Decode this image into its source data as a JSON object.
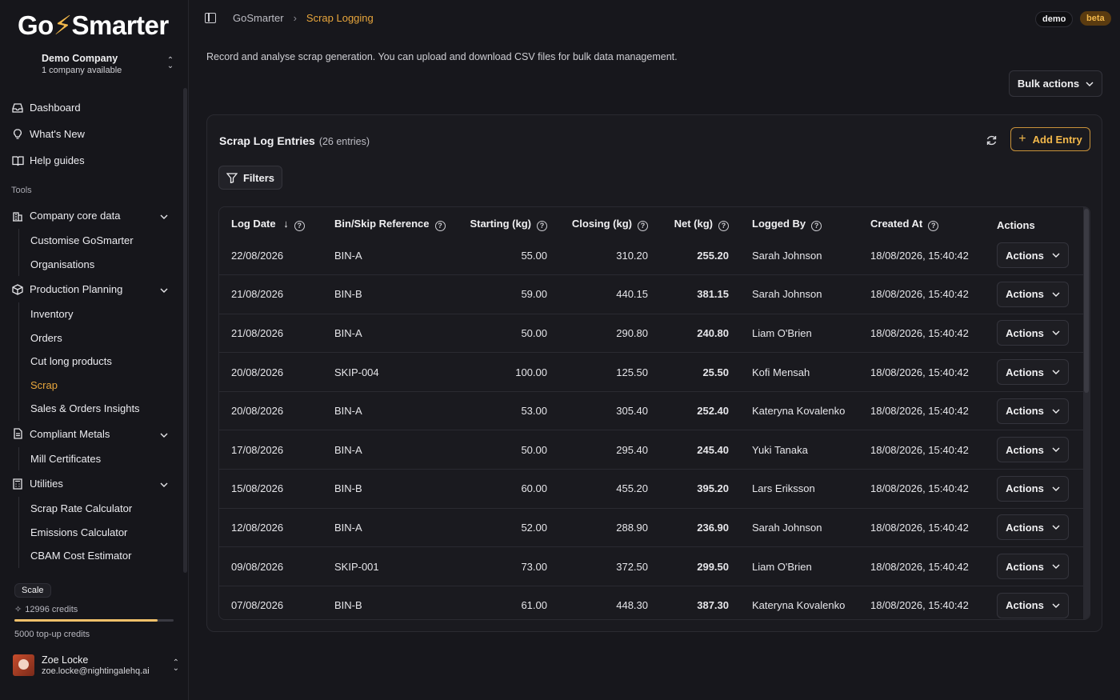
{
  "brand": {
    "logo_text_a": "Go",
    "logo_bolt": "⚡",
    "logo_text_b": "Smarter"
  },
  "company": {
    "name": "Demo Company",
    "sub": "1 company available"
  },
  "nav": {
    "dashboard": "Dashboard",
    "whats_new": "What's New",
    "help_guides": "Help guides",
    "tools_label": "Tools",
    "company_core": "Company core data",
    "company_core_items": [
      "Customise GoSmarter",
      "Organisations"
    ],
    "production": "Production Planning",
    "production_items": [
      "Inventory",
      "Orders",
      "Cut long products",
      "Scrap",
      "Sales & Orders Insights"
    ],
    "compliant": "Compliant Metals",
    "compliant_items": [
      "Mill Certificates"
    ],
    "utilities": "Utilities",
    "utilities_items": [
      "Scrap Rate Calculator",
      "Emissions Calculator",
      "CBAM Cost Estimator"
    ]
  },
  "plan": {
    "name": "Scale",
    "credits": "12996 credits",
    "topup": "5000 top-up credits",
    "credits_fraction": 0.9
  },
  "user": {
    "name": "Zoe Locke",
    "email": "zoe.locke@nightingalehq.ai"
  },
  "breadcrumb": {
    "root": "GoSmarter",
    "current": "Scrap Logging"
  },
  "tags": {
    "demo": "demo",
    "beta": "beta"
  },
  "page": {
    "description": "Record and analyse scrap generation. You can upload and download CSV files for bulk data management.",
    "bulk_actions": "Bulk actions"
  },
  "card": {
    "title": "Scrap Log Entries",
    "count": "(26 entries)",
    "add_entry": "Add Entry",
    "filters": "Filters"
  },
  "table": {
    "headers": {
      "log_date": "Log Date",
      "bin": "Bin/Skip Reference",
      "starting": "Starting (kg)",
      "closing": "Closing (kg)",
      "net": "Net (kg)",
      "logged_by": "Logged By",
      "created_at": "Created At",
      "actions": "Actions"
    },
    "rows": [
      {
        "date": "22/08/2026",
        "bin": "BIN-A",
        "start": "55.00",
        "close": "310.20",
        "net": "255.20",
        "by": "Sarah Johnson",
        "created": "18/08/2026, 15:40:42",
        "action": "Actions"
      },
      {
        "date": "21/08/2026",
        "bin": "BIN-B",
        "start": "59.00",
        "close": "440.15",
        "net": "381.15",
        "by": "Sarah Johnson",
        "created": "18/08/2026, 15:40:42",
        "action": "Actions"
      },
      {
        "date": "21/08/2026",
        "bin": "BIN-A",
        "start": "50.00",
        "close": "290.80",
        "net": "240.80",
        "by": "Liam O'Brien",
        "created": "18/08/2026, 15:40:42",
        "action": "Actions"
      },
      {
        "date": "20/08/2026",
        "bin": "SKIP-004",
        "start": "100.00",
        "close": "125.50",
        "net": "25.50",
        "by": "Kofi Mensah",
        "created": "18/08/2026, 15:40:42",
        "action": "Actions"
      },
      {
        "date": "20/08/2026",
        "bin": "BIN-A",
        "start": "53.00",
        "close": "305.40",
        "net": "252.40",
        "by": "Kateryna Kovalenko",
        "created": "18/08/2026, 15:40:42",
        "action": "Actions"
      },
      {
        "date": "17/08/2026",
        "bin": "BIN-A",
        "start": "50.00",
        "close": "295.40",
        "net": "245.40",
        "by": "Yuki Tanaka",
        "created": "18/08/2026, 15:40:42",
        "action": "Actions"
      },
      {
        "date": "15/08/2026",
        "bin": "BIN-B",
        "start": "60.00",
        "close": "455.20",
        "net": "395.20",
        "by": "Lars Eriksson",
        "created": "18/08/2026, 15:40:42",
        "action": "Actions"
      },
      {
        "date": "12/08/2026",
        "bin": "BIN-A",
        "start": "52.00",
        "close": "288.90",
        "net": "236.90",
        "by": "Sarah Johnson",
        "created": "18/08/2026, 15:40:42",
        "action": "Actions"
      },
      {
        "date": "09/08/2026",
        "bin": "SKIP-001",
        "start": "73.00",
        "close": "372.50",
        "net": "299.50",
        "by": "Liam O'Brien",
        "created": "18/08/2026, 15:40:42",
        "action": "Actions"
      },
      {
        "date": "07/08/2026",
        "bin": "BIN-B",
        "start": "61.00",
        "close": "448.30",
        "net": "387.30",
        "by": "Kateryna Kovalenko",
        "created": "18/08/2026, 15:40:42",
        "action": "Actions"
      }
    ]
  },
  "colors": {
    "accent": "#e8a63c",
    "background": "#17171c",
    "card": "#1a1a1f",
    "border": "#2a2a31"
  }
}
